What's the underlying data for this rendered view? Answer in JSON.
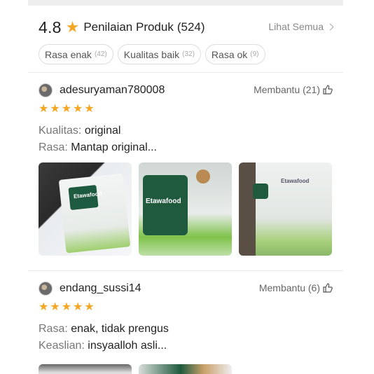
{
  "summary": {
    "rating": "4.8",
    "title": "Penilaian Produk",
    "count": "(524)",
    "see_all": "Lihat Semua",
    "colors": {
      "star": "#f5a623"
    }
  },
  "filters": [
    {
      "label": "Rasa enak",
      "count": "(42)"
    },
    {
      "label": "Kualitas baik",
      "count": "(32)"
    },
    {
      "label": "Rasa ok",
      "count": "(9)"
    }
  ],
  "reviews": [
    {
      "username": "adesuryaman780008",
      "helpful": "Membantu (21)",
      "stars": 5,
      "lines": [
        {
          "label": "Kualitas:",
          "value": "original"
        },
        {
          "label": "Rasa:",
          "value": "Mantap original..."
        }
      ],
      "photos": [
        {
          "brand": "Etawafood"
        },
        {
          "brand": "Etawafood"
        },
        {
          "brand": "Etawafood"
        }
      ]
    },
    {
      "username": "endang_sussi14",
      "helpful": "Membantu (6)",
      "stars": 5,
      "lines": [
        {
          "label": "Rasa:",
          "value": "enak, tidak prengus"
        },
        {
          "label": "Keaslian:",
          "value": "insyaalloh asli..."
        }
      ]
    }
  ]
}
